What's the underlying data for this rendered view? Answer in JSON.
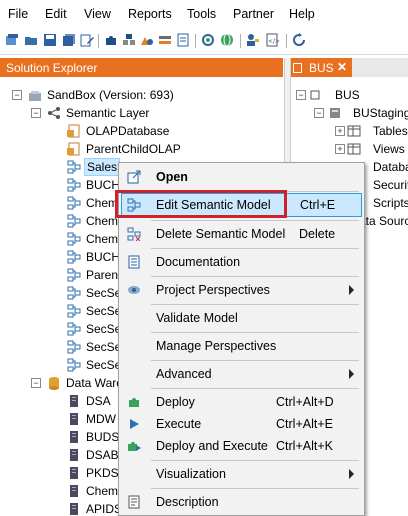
{
  "menubar": [
    "File",
    "Edit",
    "View",
    "Reports",
    "Tools",
    "Partner",
    "Help"
  ],
  "solution_explorer": {
    "title": "Solution Explorer",
    "tree": [
      {
        "label": "SandBox (Version: 693)",
        "icon": "sandbox-icon"
      },
      {
        "label": "Semantic Layer",
        "icon": "semantic-layer-icon"
      },
      {
        "label": "OLAPDatabase",
        "icon": "olap-database-icon"
      },
      {
        "label": "ParentChildOLAP",
        "icon": "olap-database-icon"
      },
      {
        "label": "Sales",
        "icon": "semantic-model-icon"
      },
      {
        "label": "BUCHE",
        "icon": "semantic-model-icon"
      },
      {
        "label": "ChemI",
        "icon": "semantic-model-icon"
      },
      {
        "label": "ChemI",
        "icon": "semantic-model-icon"
      },
      {
        "label": "ChemS",
        "icon": "semantic-model-icon"
      },
      {
        "label": "BUCHE",
        "icon": "semantic-model-icon"
      },
      {
        "label": "Parents",
        "icon": "semantic-model-icon"
      },
      {
        "label": "SecSe",
        "icon": "semantic-model-icon"
      },
      {
        "label": "SecSe",
        "icon": "semantic-model-icon"
      },
      {
        "label": "SecSe",
        "icon": "semantic-model-icon"
      },
      {
        "label": "SecSe",
        "icon": "semantic-model-icon"
      },
      {
        "label": "SecSe",
        "icon": "semantic-model-icon"
      },
      {
        "label": "Data Ware",
        "icon": "data-warehouse-icon"
      },
      {
        "label": "DSA",
        "icon": "data-source-icon"
      },
      {
        "label": "MDW",
        "icon": "data-source-icon"
      },
      {
        "label": "BUDSA",
        "icon": "data-source-icon"
      },
      {
        "label": "DSABU",
        "icon": "data-source-icon"
      },
      {
        "label": "PKDSA",
        "icon": "data-source-icon"
      },
      {
        "label": "ChemD",
        "icon": "data-source-icon"
      },
      {
        "label": "APIDS",
        "icon": "data-source-icon"
      }
    ]
  },
  "bus_panel": {
    "tab_label": "BUS",
    "tree": [
      {
        "label": "BUS"
      },
      {
        "label": "BUStaging"
      },
      {
        "label": "Tables"
      },
      {
        "label": "Views"
      },
      {
        "label": "Databa"
      },
      {
        "label": "Security"
      },
      {
        "label": "Scripts"
      },
      {
        "label": "ata Source"
      }
    ]
  },
  "context_menu": {
    "items": [
      {
        "label": "Open",
        "shortcut": "",
        "icon": "open-icon"
      },
      {
        "label": "Edit Semantic Model",
        "shortcut": "Ctrl+E",
        "icon": "semantic-model-icon"
      },
      {
        "label": "Delete Semantic Model",
        "shortcut": "Delete",
        "icon": "delete-model-icon"
      },
      {
        "label": "Documentation",
        "shortcut": "",
        "icon": "documentation-icon"
      },
      {
        "label": "Project Perspectives",
        "shortcut": "",
        "icon": "perspectives-icon"
      },
      {
        "label": "Validate Model",
        "shortcut": "",
        "icon": ""
      },
      {
        "label": "Manage Perspectives",
        "shortcut": "",
        "icon": ""
      },
      {
        "label": "Advanced",
        "shortcut": "",
        "icon": ""
      },
      {
        "label": "Deploy",
        "shortcut": "Ctrl+Alt+D",
        "icon": "deploy-icon"
      },
      {
        "label": "Execute",
        "shortcut": "Ctrl+Alt+E",
        "icon": "execute-icon"
      },
      {
        "label": "Deploy and Execute",
        "shortcut": "Ctrl+Alt+K",
        "icon": "deploy-execute-icon"
      },
      {
        "label": "Visualization",
        "shortcut": "",
        "icon": ""
      },
      {
        "label": "Description",
        "shortcut": "",
        "icon": "description-icon"
      }
    ]
  },
  "colors": {
    "accent_orange": "#e8701f",
    "selection_blue": "#cce8ff",
    "highlight_red": "#d0202a"
  }
}
